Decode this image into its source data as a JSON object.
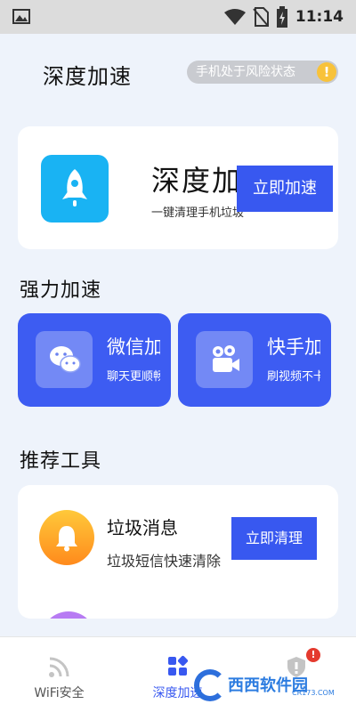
{
  "status_bar": {
    "time": "11:14",
    "icons": [
      "image-icon",
      "wifi-icon",
      "no-sim-icon",
      "battery-charging-icon"
    ]
  },
  "header": {
    "title": "深度加速",
    "risk_text": "手机处于风险状态",
    "risk_icon": "!"
  },
  "main_card": {
    "title": "深度加速",
    "subtitle": "一键清理手机垃圾",
    "button_label": "立即加速",
    "icon": "rocket-icon"
  },
  "power_section": {
    "title": "强力加速",
    "cards": [
      {
        "name": "微信加速",
        "desc": "聊天更顺畅",
        "icon": "wechat-icon"
      },
      {
        "name": "快手加速",
        "desc": "刷视频不卡",
        "icon": "kuaishou-icon"
      }
    ]
  },
  "tools_section": {
    "title": "推荐工具",
    "items": [
      {
        "name": "垃圾消息",
        "desc": "垃圾短信快速清除",
        "button_label": "立即清理",
        "icon": "bell-icon"
      }
    ]
  },
  "bottom_nav": {
    "items": [
      {
        "label": "WiFi安全",
        "icon": "wifi-signal-icon",
        "active": false
      },
      {
        "label": "深度加速",
        "icon": "grid-icon",
        "active": true
      },
      {
        "label": "",
        "icon": "shield-icon",
        "active": false,
        "badge": "!"
      }
    ]
  },
  "watermark": {
    "text": "西西软件园",
    "url": "CR173.COM"
  },
  "colors": {
    "accent": "#3858f0",
    "rocket_bg": "#19b3f3",
    "card_blue": "#3d5cf2",
    "warning": "#f8c23a",
    "badge_red": "#e43a2e"
  }
}
